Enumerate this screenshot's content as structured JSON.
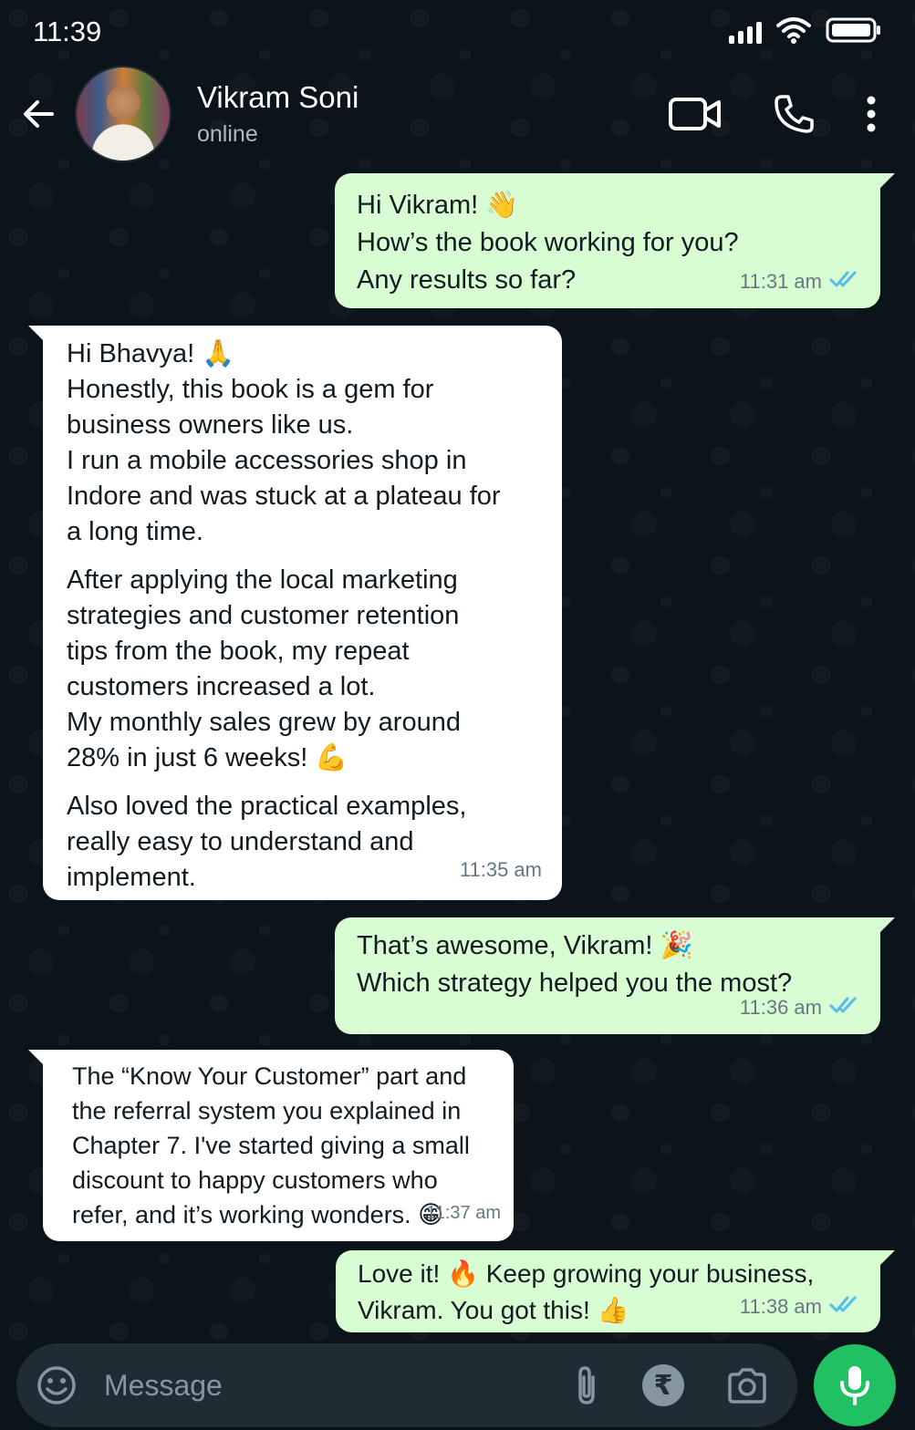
{
  "status_bar": {
    "time": "11:39"
  },
  "header": {
    "contact_name": "Vikram Soni",
    "contact_status": "online"
  },
  "messages": [
    {
      "direction": "outgoing",
      "lines": [
        "Hi Vikram! 👋",
        "How’s the book working for you?",
        "Any results so far?"
      ],
      "time": "11:31 am",
      "read": true
    },
    {
      "direction": "incoming",
      "paragraphs": [
        [
          "Hi Bhavya! 🙏",
          "Honestly, this book is a gem for",
          "business owners like us.",
          "I run a mobile accessories shop in",
          "Indore and was stuck at a plateau for",
          "a long time."
        ],
        [
          "After applying the local marketing",
          "strategies and customer retention",
          "tips from the book, my repeat",
          "customers increased a lot.",
          "My monthly sales grew by around",
          "28% in just 6 weeks! 💪"
        ],
        [
          "Also loved the practical examples,",
          "really easy to understand and",
          "implement."
        ]
      ],
      "time": "11:35 am"
    },
    {
      "direction": "outgoing",
      "lines": [
        "That’s awesome, Vikram! 🎉",
        "Which strategy helped you the most?"
      ],
      "time": "11:36 am",
      "read": true
    },
    {
      "direction": "incoming",
      "lines": [
        "The “Know Your Customer” part and",
        "the referral system you explained in",
        "Chapter 7. I've started giving a small",
        "discount to happy customers who",
        "refer, and it’s working wonders. 😁"
      ],
      "time": "11:37 am"
    },
    {
      "direction": "outgoing",
      "lines": [
        "Love it! 🔥 Keep growing your business,",
        "Vikram. You got this! 👍"
      ],
      "time": "11:38 am",
      "read": true
    }
  ],
  "input": {
    "placeholder": "Message",
    "rupee_symbol": "₹"
  },
  "colors": {
    "background": "#0b141a",
    "outgoing_bubble": "#d9fdd3",
    "incoming_bubble": "#ffffff",
    "read_ticks": "#53bdeb",
    "mic_button": "#21c063"
  },
  "icons": [
    "back-arrow-icon",
    "video-call-icon",
    "phone-icon",
    "more-options-icon",
    "emoji-icon",
    "attach-icon",
    "rupee-icon",
    "camera-icon",
    "mic-icon",
    "signal-icon",
    "wifi-icon",
    "battery-icon",
    "double-check-icon"
  ]
}
